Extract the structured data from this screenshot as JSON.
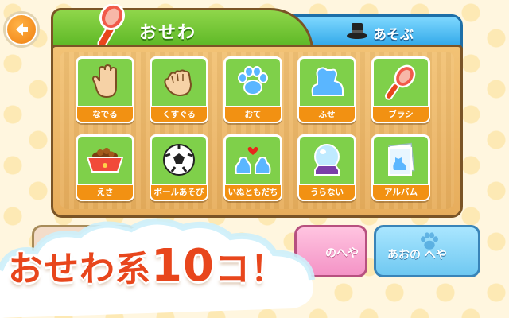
{
  "header": {
    "back_icon": "arrow-left-icon",
    "tabs": [
      {
        "label": "おせわ",
        "icon": "brush-icon",
        "active": true,
        "color": "#6cc62e"
      },
      {
        "label": "あそぶ",
        "icon": "top-hat-icon",
        "active": false,
        "color": "#3ab0ec"
      }
    ]
  },
  "tiles": [
    {
      "label": "なでる",
      "icon": "open-hand-icon"
    },
    {
      "label": "くすぐる",
      "icon": "tickle-hand-icon"
    },
    {
      "label": "おて",
      "icon": "paw-icon"
    },
    {
      "label": "ふせ",
      "icon": "lying-dog-icon"
    },
    {
      "label": "ブラシ",
      "icon": "brush-icon"
    },
    {
      "label": "えさ",
      "icon": "food-bowl-icon"
    },
    {
      "label": "ボールあそび",
      "icon": "soccer-ball-icon"
    },
    {
      "label": "いぬともだち",
      "icon": "dog-friends-heart-icon"
    },
    {
      "label": "うらない",
      "icon": "crystal-ball-icon"
    },
    {
      "label": "アルバム",
      "icon": "photo-album-icon"
    }
  ],
  "rooms": [
    {
      "label": "",
      "partial": "left"
    },
    {
      "label": "のへや",
      "color": "#f493c6"
    },
    {
      "label": "あおの へや",
      "color": "#6fc8f1"
    }
  ],
  "promo": {
    "prefix": "おせわ系",
    "number": "10",
    "suffix": "コ！"
  },
  "colors": {
    "tile_green": "#7fd04a",
    "label_orange": "#f29112",
    "board_wood": "#e7ad5c",
    "accent_red": "#e8461c"
  }
}
